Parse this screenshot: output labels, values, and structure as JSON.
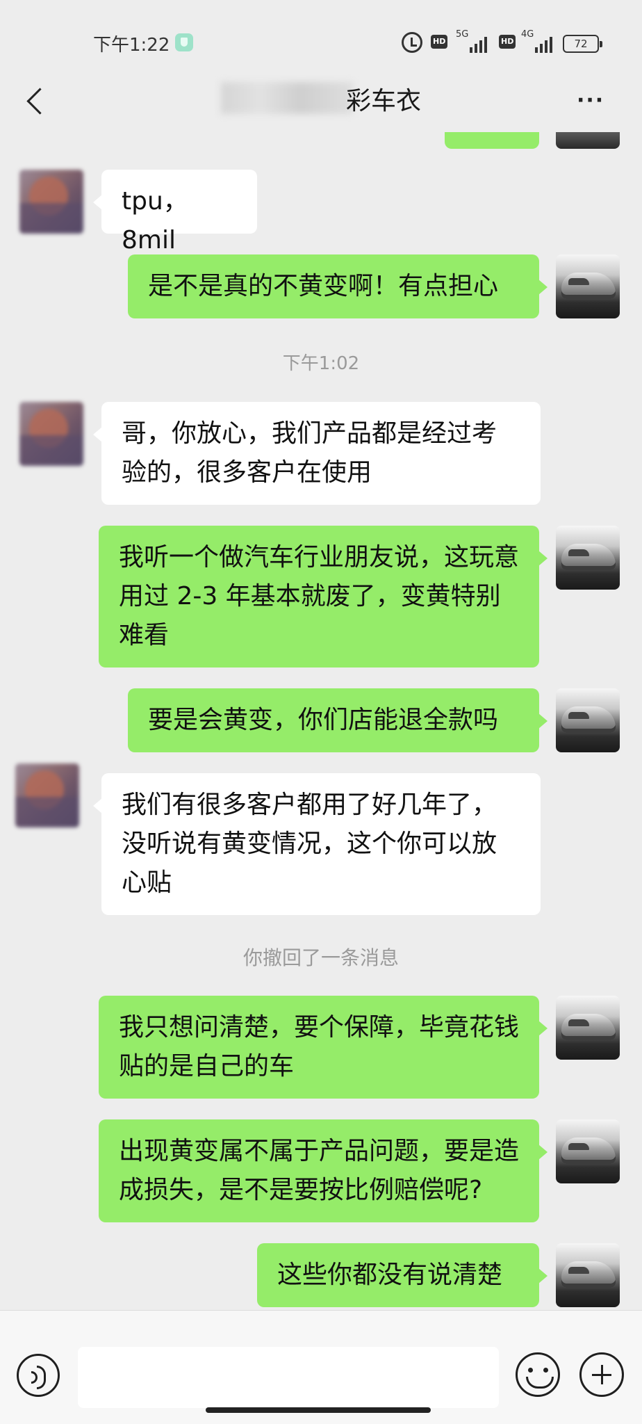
{
  "status_bar": {
    "time": "下午1:22",
    "network_1": "5G",
    "network_2": "4G",
    "hd_label": "HD",
    "battery": "72"
  },
  "header": {
    "title": "彩车衣",
    "more_label": "···"
  },
  "messages": {
    "m1": "tpu，8mil",
    "m2": "是不是真的不黄变啊！有点担心",
    "time_sep": "下午1:02",
    "m3": "哥，你放心，我们产品都是经过考验的，很多客户在使用",
    "m4": "我听一个做汽车行业朋友说，这玩意用过 2-3 年基本就废了，变黄特别难看",
    "m5": "要是会黄变，你们店能退全款吗",
    "m6": "我们有很多客户都用了好几年了，没听说有黄变情况，这个你可以放心贴",
    "recall": "你撤回了一条消息",
    "m7": "我只想问清楚，要个保障，毕竟花钱贴的是自己的车",
    "m8": "出现黄变属不属于产品问题，要是造成损失，是不是要按比例赔偿呢?",
    "m9": "这些你都没有说清楚"
  },
  "input_bar": {
    "placeholder": ""
  },
  "colors": {
    "background": "#ededed",
    "outgoing_bubble": "#95ec69",
    "incoming_bubble": "#ffffff"
  }
}
